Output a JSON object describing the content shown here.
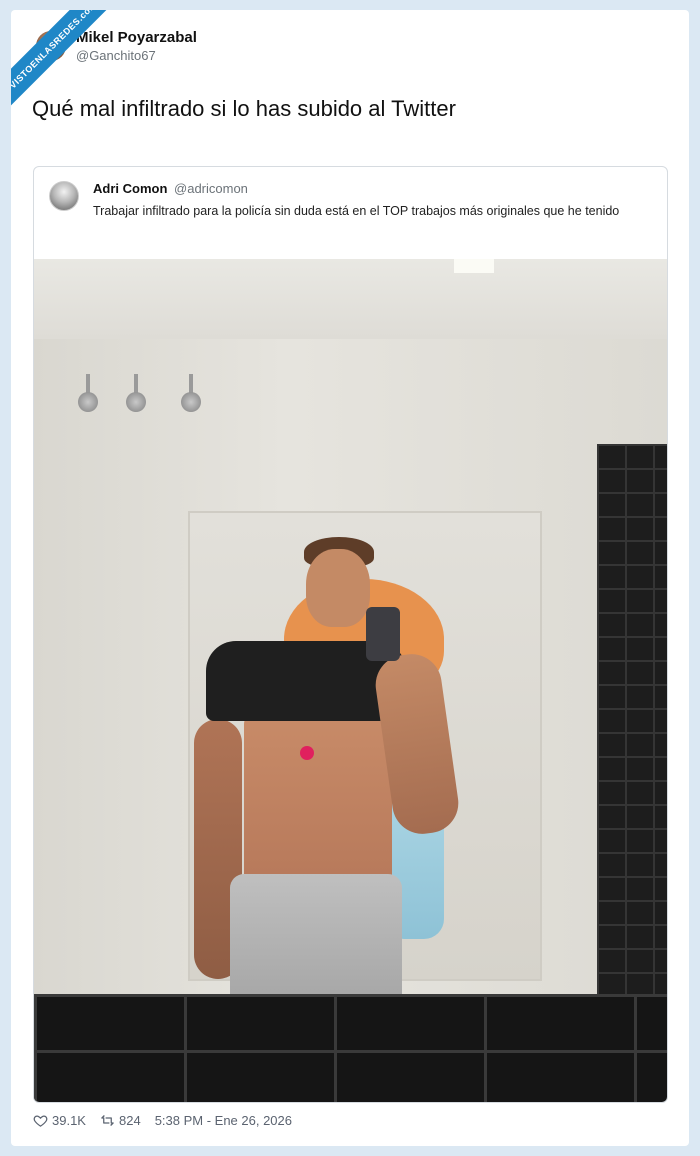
{
  "watermark": {
    "text": "VISTOENLASREDES.com"
  },
  "author": {
    "name": "Mikel Poyarzabal",
    "handle": "@Ganchito67"
  },
  "tweet": {
    "text": "Qué mal infiltrado si lo has subido al Twitter"
  },
  "quoted": {
    "name": "Adri Comon",
    "handle": "@adricomon",
    "text": "Trabajar infiltrado para la policía sin duda está en el TOP trabajos más originales que he tenido"
  },
  "stats": {
    "likes": "39.1K",
    "retweets": "824",
    "timestamp": "5:38 PM - Ene 26, 2026"
  },
  "icons": {
    "like": "heart-icon",
    "retweet": "retweet-icon"
  },
  "colors": {
    "page_bg": "#dbe8f3",
    "ribbon": "#1f87c7"
  }
}
